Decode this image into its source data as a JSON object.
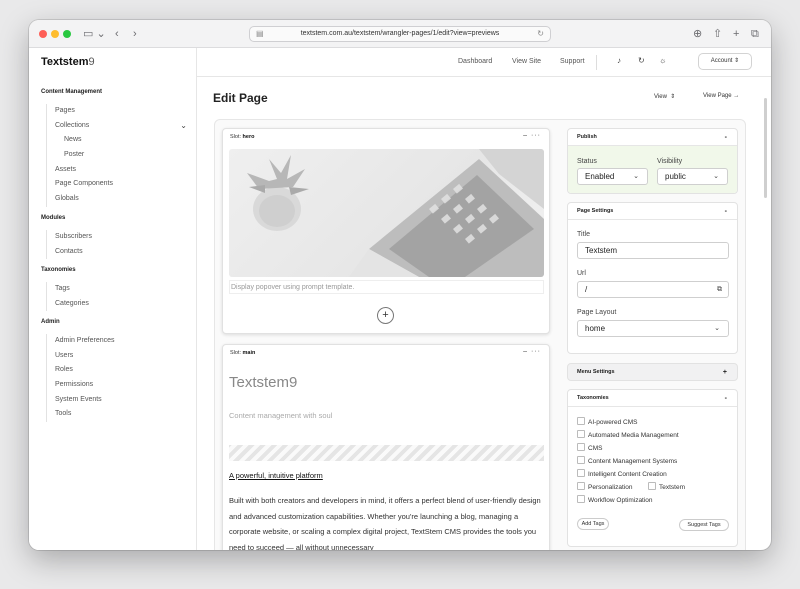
{
  "browser": {
    "url": "textstem.com.au/textstem/wrangler-pages/1/edit?view=previews"
  },
  "app": {
    "brand_name": "Textstem",
    "brand_suffix": "9"
  },
  "sidebar": {
    "sections": [
      {
        "title": "Content Management",
        "items": [
          "Pages",
          "Collections",
          "News",
          "Poster",
          "Assets",
          "Page Components",
          "Globals"
        ]
      },
      {
        "title": "Modules",
        "items": [
          "Subscribers",
          "Contacts"
        ]
      },
      {
        "title": "Taxonomies",
        "items": [
          "Tags",
          "Categories"
        ]
      },
      {
        "title": "Admin",
        "items": [
          "Admin Preferences",
          "Users",
          "Roles",
          "Permissions",
          "System Events",
          "Tools"
        ]
      }
    ]
  },
  "topbar": {
    "links": [
      "Dashboard",
      "View Site",
      "Support"
    ],
    "account_label": "Account"
  },
  "page": {
    "title": "Edit Page",
    "view_select": "View",
    "view_page": "View Page →"
  },
  "slots": {
    "hero": {
      "label": "Slot:",
      "name": "hero",
      "prompt_placeholder": "Display popover using prompt template."
    },
    "main": {
      "label": "Slot:",
      "name": "main",
      "title": "Textstem9",
      "subtitle": "Content management with soul",
      "heading": "A powerful, intuitive platform",
      "body": "Built with both creators and developers in mind, it offers a perfect blend of user-friendly design and advanced customization capabilities. Whether you're launching a blog, managing a corporate website, or scaling a complex digital project, TextStem CMS provides the tools you need to succeed — all without unnecessary"
    }
  },
  "publish": {
    "title": "Publish",
    "status_label": "Status",
    "status_value": "Enabled",
    "visibility_label": "Visibility",
    "visibility_value": "public"
  },
  "page_settings": {
    "title": "Page Settings",
    "title_label": "Title",
    "title_value": "Textstem",
    "url_label": "Url",
    "url_value": "/",
    "layout_label": "Page Layout",
    "layout_value": "home"
  },
  "menu_settings": {
    "title": "Menu Settings"
  },
  "taxonomies": {
    "title": "Taxonomies",
    "rows": [
      [
        "AI-powered CMS"
      ],
      [
        "Automated Media Management"
      ],
      [
        "CMS"
      ],
      [
        "Content Management Systems"
      ],
      [
        "Intelligent Content Creation"
      ],
      [
        "Personalization",
        "Textstem"
      ],
      [
        "Workflow Optimization"
      ]
    ],
    "add_tags": "Add Tags",
    "suggest_tags": "Suggest Tags"
  },
  "colors": {
    "publish_bg": "#f1f8ea",
    "accent_dark": "#111111"
  }
}
